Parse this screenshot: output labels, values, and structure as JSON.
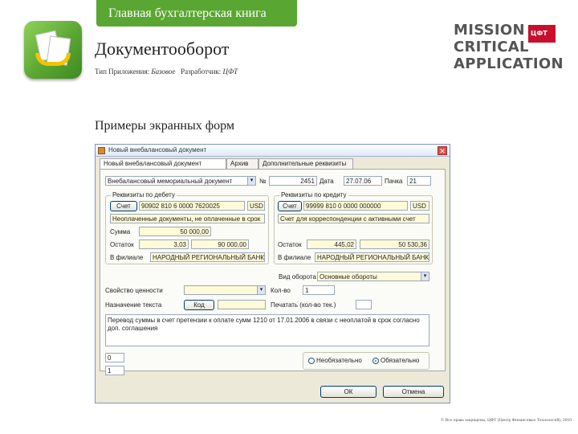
{
  "header": {
    "book_tab": "Главная бухгалтерская книга",
    "app_title": "Документооборот",
    "type_label": "Тип Приложения:",
    "type_value": "Базовое",
    "developer_label": "Разработчик:",
    "developer_value": "ЦФТ"
  },
  "logo": {
    "line1": "MISSION",
    "line2": "CRITICAL",
    "line3": "APPLICATION",
    "badge": "ЦФТ"
  },
  "section_heading": "Примеры экранных форм",
  "dialog": {
    "title": "Новый внебалансовый документ",
    "close": "✕",
    "tabs": [
      "Новый внебалансовый документ",
      "Архив",
      "Дополнительные реквизиты"
    ],
    "doc_type": "Внебалансовый мемориальный документ",
    "num_label": "№",
    "num_value": "2451",
    "date_label": "Дата",
    "date_value": "27.07.06",
    "pack_label": "Пачка",
    "pack_value": "21",
    "debit": {
      "title": "Реквизиты по дебету",
      "account_btn": "Счет",
      "account": "90902 810 6 0000 7620025",
      "currency": "USD",
      "account_name": "Неоплаченные документы, не оплаченные в срок",
      "sum_label": "Сумма",
      "sum": "50 000,00",
      "rest_label": "Остаток",
      "rest_rate": "3,03",
      "rest_value": "90 000,00",
      "branch_label": "В филиале",
      "branch": "НАРОДНЫЙ РЕГИОНАЛЬНЫЙ БАНК"
    },
    "credit": {
      "title": "Реквизиты по кредиту",
      "account_btn": "Счет",
      "account": "99999 810 0 0000 000000",
      "currency": "USD",
      "account_name": "Счет для корреспонденции с активными счет",
      "rest_label": "Остаток",
      "rest_rate": "445,02",
      "rest_value": "50 530,36",
      "branch_label": "В филиале",
      "branch": "НАРОДНЫЙ РЕГИОНАЛЬНЫЙ БАНК"
    },
    "turnover_label": "Вид оборота",
    "turnover_value": "Основные обороты",
    "property_label": "Свойство ценности",
    "quantity_label": "Кол-во",
    "quantity_value": "1",
    "purpose_label": "Назначение текста",
    "code_label": "Код",
    "print_label": "Печатать (кол-во тек.)",
    "purpose_text": "Перевод суммы в счет претензии к оплате сумм 1210 от 17.01.2006 в связи с неоплатой в срок согласно доп. соглашения",
    "small_field_1": "0",
    "small_field_2": "1",
    "radio_1": "Необязательно",
    "radio_2": "Обязательно",
    "ok": "ОК",
    "cancel": "Отмена"
  },
  "copyright": "© Все права защищены, ЦФТ (Центр Финансовых Технологий), 2010"
}
